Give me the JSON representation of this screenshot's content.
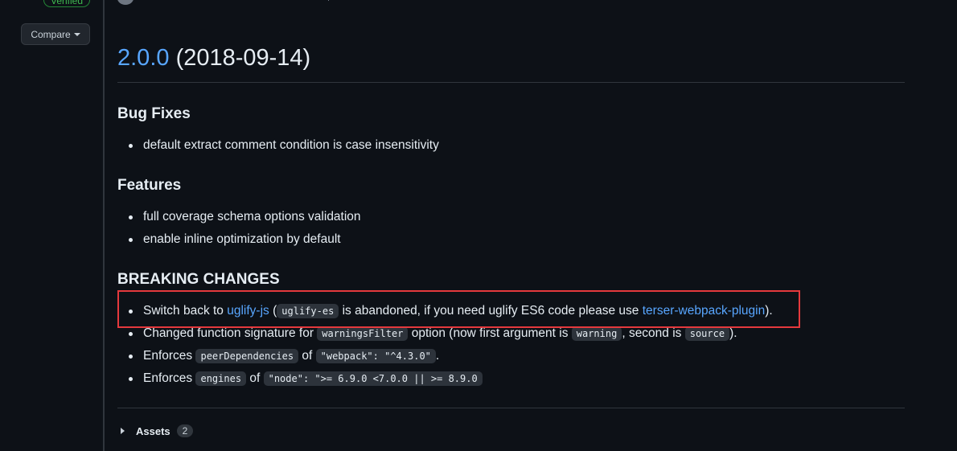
{
  "sidebar": {
    "verified_label": "Verified",
    "compare_label": "Compare"
  },
  "release": {
    "version": "2.0.0",
    "date": "(2018-09-14)"
  },
  "sections": {
    "bug_fixes": {
      "heading": "Bug Fixes",
      "items": [
        "default extract comment condition is case insensitivity"
      ]
    },
    "features": {
      "heading": "Features",
      "items": [
        "full coverage schema options validation",
        "enable inline optimization by default"
      ]
    },
    "breaking": {
      "heading": "BREAKING CHANGES",
      "item1": {
        "t1": "Switch back to ",
        "link1": "uglify-js",
        "t2": " (",
        "code1": "uglify-es",
        "t3": " is abandoned, if you need uglify ES6 code please use ",
        "link2": "terser-webpack-plugin",
        "t4": ")."
      },
      "item2": {
        "t1": "Changed function signature for ",
        "code1": "warningsFilter",
        "t2": " option (now first argument is ",
        "code2": "warning",
        "t3": ", second is ",
        "code3": "source",
        "t4": ")."
      },
      "item3": {
        "t1": "Enforces ",
        "code1": "peerDependencies",
        "t2": " of ",
        "code2": "\"webpack\": \"^4.3.0\"",
        "t3": "."
      },
      "item4": {
        "t1": "Enforces ",
        "code1": "engines",
        "t2": " of ",
        "code2": "\"node\": \">= 6.9.0 <7.0.0 || >= 8.9.0"
      }
    }
  },
  "assets": {
    "label": "Assets",
    "count": "2"
  },
  "colors": {
    "background": "#0d1117",
    "link": "#58a6ff",
    "highlight": "#e5393d",
    "verified": "#3fb950"
  }
}
